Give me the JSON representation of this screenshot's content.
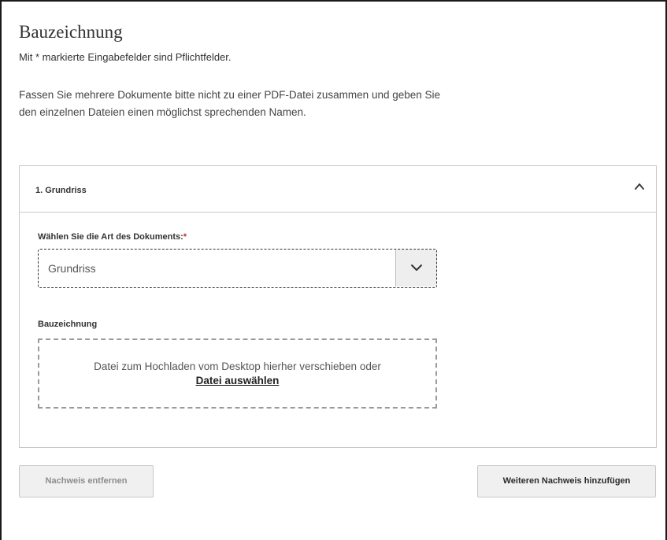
{
  "page": {
    "title": "Bauzeichnung",
    "required_note": "Mit * markierte Eingabefelder sind Pflichtfelder.",
    "intro": "Fassen Sie mehrere Dokumente bitte nicht zu einer PDF-Datei zusammen und geben Sie den einzelnen Dateien einen möglichst sprechenden Namen."
  },
  "accordion": {
    "title": "1. Grundriss",
    "expanded": true,
    "toggle_icon": "chevron-up-icon"
  },
  "document_type": {
    "label": "Wählen Sie die Art des Dokuments:",
    "required_marker": "*",
    "selected_value": "Grundriss",
    "dropdown_icon": "chevron-down-icon"
  },
  "upload": {
    "label": "Bauzeichnung",
    "drop_text": "Datei zum Hochladen vom Desktop hierher verschieben oder",
    "link_text": "Datei auswählen"
  },
  "buttons": {
    "remove_label": "Nachweis entfernen",
    "add_label": "Weiteren Nachweis hinzufügen"
  },
  "colors": {
    "required": "#c0272d",
    "border": "#c9c9c9",
    "button_bg": "#f0f0f0",
    "disabled_text": "#8c8c8c"
  }
}
